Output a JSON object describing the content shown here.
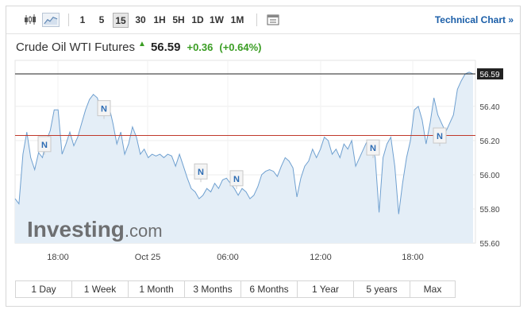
{
  "toolbar": {
    "chart_type_icons": [
      "candlestick-icon",
      "line-chart-icon"
    ],
    "timeframes": [
      "1",
      "5",
      "15",
      "30",
      "1H",
      "5H",
      "1D",
      "1W",
      "1M"
    ],
    "active_timeframe": "15",
    "settings_icon": "chart-settings-icon",
    "technical_chart_label": "Technical Chart »"
  },
  "quote": {
    "name": "Crude Oil WTI Futures",
    "direction_icon": "up-arrow-icon",
    "price": "56.59",
    "change": "+0.36",
    "change_percent": "(+0.64%)",
    "up_color": "#3a9d23"
  },
  "watermark": {
    "brand": "Investing",
    "suffix": ".com"
  },
  "chart_data": {
    "type": "area",
    "x_ticks": [
      "18:00",
      "Oct 25",
      "06:00",
      "12:00",
      "18:00"
    ],
    "y_ticks": [
      "56.59",
      "56.40",
      "56.20",
      "56.00",
      "55.80",
      "55.60"
    ],
    "ylim": [
      55.6,
      56.62
    ],
    "current_price": 56.59,
    "reference_line": 56.23,
    "line_color": "#6fa0d0",
    "fill_color": "#e4eef7",
    "reference_color": "#c0392b",
    "news_marker_label": "N",
    "news_markers": [
      56.14,
      56.35,
      55.98,
      55.94,
      56.12,
      56.19
    ],
    "series": [
      {
        "values": [
          55.86,
          55.83,
          56.12,
          56.25,
          56.1,
          56.03,
          56.13,
          56.1,
          56.2,
          56.26,
          56.38,
          56.38,
          56.12,
          56.18,
          56.25,
          56.17,
          56.22,
          56.3,
          56.38,
          56.44,
          56.47,
          56.45,
          56.37,
          56.43,
          56.4,
          56.3,
          56.18,
          56.25,
          56.12,
          56.18,
          56.28,
          56.22,
          56.12,
          56.15,
          56.1,
          56.12,
          56.11,
          56.12,
          56.1,
          56.12,
          56.11,
          56.05,
          56.12,
          56.05,
          55.98,
          55.92,
          55.9,
          55.86,
          55.88,
          55.92,
          55.9,
          55.95,
          55.92,
          55.97,
          55.98,
          55.95,
          55.92,
          55.88,
          55.92,
          55.9,
          55.86,
          55.88,
          55.93,
          56.0,
          56.02,
          56.03,
          56.02,
          55.99,
          56.05,
          56.1,
          56.08,
          56.04,
          55.87,
          55.98,
          56.05,
          56.08,
          56.15,
          56.1,
          56.15,
          56.22,
          56.2,
          56.12,
          56.15,
          56.1,
          56.18,
          56.15,
          56.2,
          56.05,
          56.1,
          56.15,
          56.2,
          56.18,
          56.1,
          55.78,
          56.1,
          56.18,
          56.22,
          56.05,
          55.77,
          55.95,
          56.1,
          56.2,
          56.38,
          56.4,
          56.32,
          56.18,
          56.3,
          56.45,
          56.35,
          56.3,
          56.25,
          56.3,
          56.35,
          56.5,
          56.55,
          56.59,
          56.6,
          56.59
        ]
      }
    ]
  },
  "ranges": [
    "1 Day",
    "1 Week",
    "1 Month",
    "3 Months",
    "6 Months",
    "1 Year",
    "5 years",
    "Max"
  ]
}
